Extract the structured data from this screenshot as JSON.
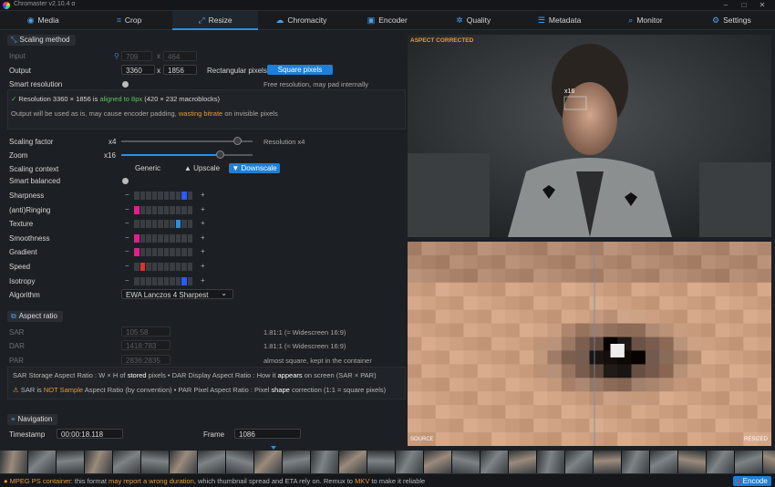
{
  "window": {
    "title": "Chromaster v2.10.4 α"
  },
  "tabs": [
    {
      "label": "Media",
      "icon": "media-icon",
      "glyph": "◉"
    },
    {
      "label": "Crop",
      "icon": "crop-icon",
      "glyph": "⌗"
    },
    {
      "label": "Resize",
      "icon": "resize-icon",
      "glyph": "⤢",
      "active": true
    },
    {
      "label": "Chromacity",
      "icon": "chromacity-icon",
      "glyph": "☁"
    },
    {
      "label": "Encoder",
      "icon": "encoder-icon",
      "glyph": "▣"
    },
    {
      "label": "Quality",
      "icon": "quality-icon",
      "glyph": "✲"
    },
    {
      "label": "Metadata",
      "icon": "metadata-icon",
      "glyph": "☰"
    },
    {
      "label": "Monitor",
      "icon": "monitor-icon",
      "glyph": "⌕"
    },
    {
      "label": "Settings",
      "icon": "settings-icon",
      "glyph": "⚙"
    }
  ],
  "scaling": {
    "section_title": "Scaling method",
    "input_label": "Input",
    "input_w": "709",
    "input_h": "464",
    "output_label": "Output",
    "output_w": "3360",
    "output_h": "1856",
    "x": "x",
    "rect_pixels": "Rectangular pixels",
    "square_pixels": "Square pixels",
    "smart_resolution": "Smart resolution",
    "smart_resolution_hint": "Free resolution, may pad internally",
    "check": "✓",
    "res_note_a": "Resolution 3360 × 1856 is",
    "res_note_b": "aligned to 8px",
    "res_note_c": "(420 × 232 macroblocks)",
    "out_note_a": "Output will be used as is, may cause encoder padding,",
    "out_note_b": "wasting bitrate",
    "out_note_c": "on invisible pixels",
    "factor_label": "Scaling factor",
    "factor_value": "x4",
    "factor_level": 0.88,
    "factor_hint": "Resolution x4",
    "zoom_label": "Zoom",
    "zoom_value": "x16",
    "zoom_level": 0.75,
    "context_label": "Scaling context",
    "context_options": [
      "Generic",
      "Upscale",
      "Downscale"
    ],
    "context_upscale_glyph": "▲",
    "context_downscale_glyph": "▼",
    "smart_balanced": "Smart balanced",
    "minus": "−",
    "plus": "+",
    "meters": [
      {
        "label": "Sharpness",
        "level": 9,
        "color": "#2a5bff"
      },
      {
        "label": "(anti)Ringing",
        "level": 1,
        "color": "#e0208c"
      },
      {
        "label": "Texture",
        "level": 8,
        "color": "#2b8fe0"
      },
      {
        "label": "Smoothness",
        "level": 1,
        "color": "#e0208c"
      },
      {
        "label": "Gradient",
        "level": 1,
        "color": "#e0208c"
      },
      {
        "label": "Speed",
        "level": 2,
        "color": "#e23030"
      },
      {
        "label": "Isotropy",
        "level": 9,
        "color": "#2a5bff"
      }
    ],
    "algorithm_label": "Algorithm",
    "algorithm_value": "EWA Lanczos 4 Sharpest",
    "algorithm_chevron": "⌄"
  },
  "aspect": {
    "section_title": "Aspect ratio",
    "sar_label": "SAR",
    "sar_value": "105:58",
    "sar_hint": "1.81:1 (≈ Widescreen 16:9)",
    "dar_label": "DAR",
    "dar_value": "1418:783",
    "dar_hint": "1.81:1 (≈ Widescreen 16:9)",
    "par_label": "PAR",
    "par_value": "2836:2835",
    "par_hint": "almost square, kept in the container",
    "note1_a": "SAR Storage Aspect Ratio : W × H of",
    "note1_b": "stored",
    "note1_c": "pixels • DAR Display Aspect Ratio : How it",
    "note1_d": "appears",
    "note1_e": "on screen (SAR × PAR)",
    "note2_a": "SAR is",
    "note2_b": "NOT Sample",
    "note2_c": "Aspect Ratio (by convention) • PAR Pixel Aspect Ratio : Pixel",
    "note2_d": "shape",
    "note2_e": "correction (1:1 = square pixels)",
    "warn_glyph": "⚠"
  },
  "navigation": {
    "section_title": "Navigation",
    "timestamp_label": "Timestamp",
    "timestamp_value": "00:00:18.118",
    "frame_label": "Frame",
    "frame_value": "1086"
  },
  "preview": {
    "badge": "ASPECT CORRECTED",
    "zoom_badge": "x16",
    "corner_left": "SOURCE",
    "corner_right": "RESIZED"
  },
  "status": {
    "bullet": "●",
    "a": "MPEG PS container",
    "b": ": this format",
    "c": "may report a wrong duration",
    "d": ", which thumbnail spread and ETA rely on. Remux to",
    "e": "MKV",
    "f": "to make it reliable",
    "encode_label": "Encode"
  },
  "colors": {
    "accent": "#1e7fd6",
    "warning": "#e89a3a",
    "ok": "#59c45a"
  }
}
